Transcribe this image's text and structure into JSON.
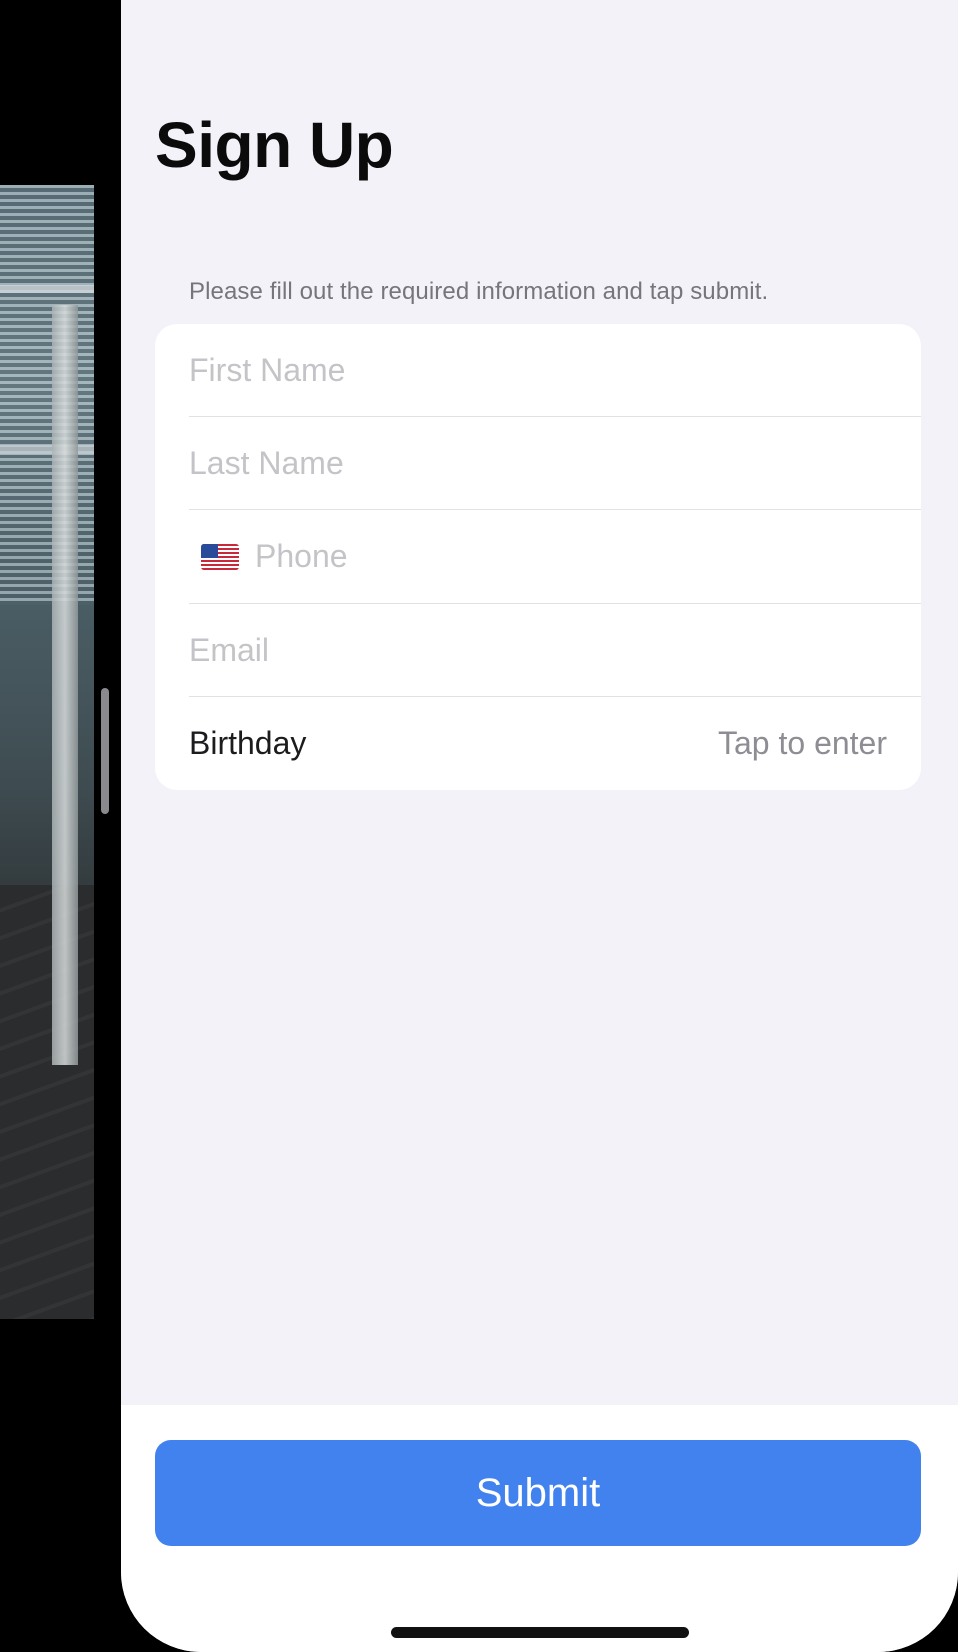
{
  "page": {
    "title": "Sign Up",
    "hint": "Please fill out the required information and tap submit."
  },
  "form": {
    "first_name": {
      "placeholder": "First Name",
      "value": ""
    },
    "last_name": {
      "placeholder": "Last Name",
      "value": ""
    },
    "phone": {
      "placeholder": "Phone",
      "value": "",
      "country_flag": "us-flag-icon"
    },
    "email": {
      "placeholder": "Email",
      "value": ""
    },
    "birthday": {
      "label": "Birthday",
      "value": "Tap to enter"
    }
  },
  "actions": {
    "submit_label": "Submit"
  },
  "colors": {
    "accent": "#4282ef",
    "background": "#f3f2f8",
    "card": "#ffffff",
    "placeholder": "#c4c4c8",
    "secondary_text": "#8e8d93"
  }
}
